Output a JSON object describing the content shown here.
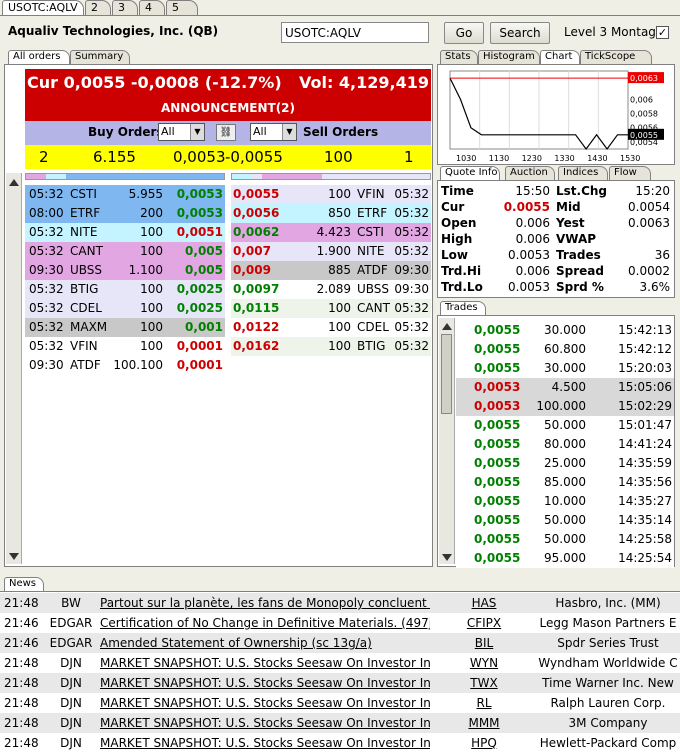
{
  "top_tabs": [
    "USOTC:AQLV",
    "2",
    "3",
    "4",
    "5"
  ],
  "header": {
    "company": "Aqualiv Technologies, Inc. (QB)",
    "symbol_value": "USOTC:AQLV",
    "go_label": "Go",
    "search_label": "Search",
    "montage_label": "Level 3 Montage",
    "montage_checked": true
  },
  "left_tabs": [
    "All orders",
    "Summary"
  ],
  "summary": {
    "cur": "Cur 0,0055 -0,0008 (-12.7%)",
    "vol": "Vol: 4,129,419",
    "announcement": "ANNOUNCEMENT(2)"
  },
  "filter": {
    "buy_label": "Buy Orders",
    "buy_select": "All",
    "sell_select": "All",
    "sell_label": "Sell Orders"
  },
  "totals": {
    "buy_count": "2",
    "buy_size": "6.155",
    "buy_price": "0,0053",
    "sell_price": "-0,0055",
    "sell_size": "100",
    "sell_count": "1"
  },
  "buy_orders": [
    {
      "time": "05:32",
      "mm": "CSTI",
      "size": "5.955",
      "price": "0,0053",
      "bg": "#7fb7f0"
    },
    {
      "time": "08:00",
      "mm": "ETRF",
      "size": "200",
      "price": "0,0053",
      "bg": "#7fb7f0"
    },
    {
      "time": "05:32",
      "mm": "NITE",
      "size": "100",
      "price": "0,0051",
      "bg": "#c4f4ff"
    },
    {
      "time": "05:32",
      "mm": "CANT",
      "size": "100",
      "price": "0,005",
      "bg": "#e2a6e2"
    },
    {
      "time": "09:30",
      "mm": "UBSS",
      "size": "1.100",
      "price": "0,005",
      "bg": "#e2a6e2"
    },
    {
      "time": "05:32",
      "mm": "BTIG",
      "size": "100",
      "price": "0,0025",
      "bg": "#e6e6f8"
    },
    {
      "time": "05:32",
      "mm": "CDEL",
      "size": "100",
      "price": "0,0025",
      "bg": "#e6e6f8"
    },
    {
      "time": "05:32",
      "mm": "MAXM",
      "size": "100",
      "price": "0,001",
      "bg": "#c8c8c8"
    },
    {
      "time": "05:32",
      "mm": "VFIN",
      "size": "100",
      "price": "0,0001",
      "bg": "#ffffff"
    },
    {
      "time": "09:30",
      "mm": "ATDF",
      "size": "100.100",
      "price": "0,0001",
      "bg": "#ffffff"
    }
  ],
  "sell_orders": [
    {
      "price": "0,0055",
      "size": "100",
      "mm": "VFIN",
      "time": "05:32",
      "bg": "#e6e6f8",
      "red": true
    },
    {
      "price": "0,0056",
      "size": "850",
      "mm": "ETRF",
      "time": "05:32",
      "bg": "#c4f4ff",
      "red": true
    },
    {
      "price": "0,0062",
      "size": "4.423",
      "mm": "CSTI",
      "time": "05:32",
      "bg": "#e2a6e2",
      "red": false
    },
    {
      "price": "0,007",
      "size": "1.900",
      "mm": "NITE",
      "time": "05:32",
      "bg": "#e6e6f8",
      "red": true
    },
    {
      "price": "0,009",
      "size": "885",
      "mm": "ATDF",
      "time": "09:30",
      "bg": "#c8c8c8",
      "red": true
    },
    {
      "price": "0,0097",
      "size": "2.089",
      "mm": "UBSS",
      "time": "09:30",
      "bg": "#ffffff",
      "red": false
    },
    {
      "price": "0,0115",
      "size": "100",
      "mm": "CANT",
      "time": "05:32",
      "bg": "#eef4ea",
      "red": false
    },
    {
      "price": "0,0122",
      "size": "100",
      "mm": "CDEL",
      "time": "05:32",
      "bg": "#ffffff",
      "red": true
    },
    {
      "price": "0,0162",
      "size": "100",
      "mm": "BTIG",
      "time": "05:32",
      "bg": "#eef4ea",
      "red": true
    }
  ],
  "right_tabs": [
    "Stats",
    "Histogram",
    "Chart",
    "TickScope"
  ],
  "chart": {
    "y_labels": [
      "0,0063",
      "0,006",
      "0,0058",
      "0,0056",
      "0,0055",
      "0,0054"
    ],
    "x_labels": [
      "1030",
      "1130",
      "1230",
      "1330",
      "1430",
      "1530"
    ]
  },
  "chart_data": {
    "type": "line",
    "x": [
      "09:30",
      "09:45",
      "10:00",
      "10:30",
      "11:00",
      "11:30",
      "12:00",
      "12:30",
      "13:00",
      "13:30",
      "14:00",
      "14:30",
      "15:00",
      "15:10",
      "15:20",
      "15:30",
      "15:40",
      "15:50"
    ],
    "values": [
      0.0063,
      0.006,
      0.0056,
      0.0055,
      0.0055,
      0.0055,
      0.0055,
      0.0055,
      0.0055,
      0.0055,
      0.0055,
      0.0055,
      0.0055,
      0.0053,
      0.0055,
      0.0053,
      0.0055,
      0.0055
    ],
    "yticks": [
      "0,0063",
      "0,006",
      "0,0058",
      "0,0056",
      "0,0055",
      "0,0054"
    ],
    "xticks": [
      "1030",
      "1130",
      "1230",
      "1330",
      "1430",
      "1530"
    ]
  },
  "quote_tabs": [
    "Quote Info",
    "Auction",
    "Indices",
    "Flow"
  ],
  "quote": [
    {
      "l1": "Time",
      "v1": "15:50",
      "l2": "Lst.Chg",
      "v2": "15:20",
      "red1": false
    },
    {
      "l1": "Cur",
      "v1": "0.0055",
      "l2": "Mid",
      "v2": "0.0054",
      "red1": true
    },
    {
      "l1": "Open",
      "v1": "0.006",
      "l2": "Yest",
      "v2": "0.0063",
      "red1": false
    },
    {
      "l1": "High",
      "v1": "0.006",
      "l2": "VWAP",
      "v2": "",
      "red1": false
    },
    {
      "l1": "Low",
      "v1": "0.0053",
      "l2": "Trades",
      "v2": "36",
      "red1": false
    },
    {
      "l1": "Trd.Hi",
      "v1": "0.006",
      "l2": "Spread",
      "v2": "0.0002",
      "red1": false
    },
    {
      "l1": "Trd.Lo",
      "v1": "0.0053",
      "l2": "Sprd %",
      "v2": "3.6%",
      "red1": false
    }
  ],
  "trades_tab": "Trades",
  "trades": [
    {
      "price": "0,0055",
      "size": "30.000",
      "time": "15:42:13",
      "red": false
    },
    {
      "price": "0,0055",
      "size": "60.800",
      "time": "15:42:12",
      "red": false
    },
    {
      "price": "0,0055",
      "size": "30.000",
      "time": "15:20:03",
      "red": false
    },
    {
      "price": "0,0053",
      "size": "4.500",
      "time": "15:05:06",
      "red": true
    },
    {
      "price": "0,0053",
      "size": "100.000",
      "time": "15:02:29",
      "red": true
    },
    {
      "price": "0,0055",
      "size": "50.000",
      "time": "15:01:47",
      "red": false
    },
    {
      "price": "0,0055",
      "size": "80.000",
      "time": "14:41:24",
      "red": false
    },
    {
      "price": "0,0055",
      "size": "25.000",
      "time": "14:35:59",
      "red": false
    },
    {
      "price": "0,0055",
      "size": "85.000",
      "time": "14:35:56",
      "red": false
    },
    {
      "price": "0,0055",
      "size": "10.000",
      "time": "14:35:27",
      "red": false
    },
    {
      "price": "0,0055",
      "size": "50.000",
      "time": "14:35:14",
      "red": false
    },
    {
      "price": "0,0055",
      "size": "50.000",
      "time": "14:25:58",
      "red": false
    },
    {
      "price": "0,0055",
      "size": "95.000",
      "time": "14:25:54",
      "red": false
    }
  ],
  "news_tab": "News",
  "news": [
    {
      "time": "21:48",
      "src": "BW",
      "headline": "Partout sur la planète, les fans de Monopoly concluent que...",
      "sym": "HAS",
      "company": "Hasbro, Inc. (MM)"
    },
    {
      "time": "21:46",
      "src": "EDGAR",
      "headline": "Certification of No Change in Definitive Materials. (497j)",
      "sym": "CFIPX",
      "company": "Legg Mason Partners E"
    },
    {
      "time": "21:46",
      "src": "EDGAR",
      "headline": "Amended Statement of Ownership (sc 13g/a)",
      "sym": "BIL",
      "company": "Spdr Series Trust"
    },
    {
      "time": "21:48",
      "src": "DJN",
      "headline": "MARKET SNAPSHOT: U.S. Stocks Seesaw On Investor Ind...",
      "sym": "WYN",
      "company": "Wyndham Worldwide C"
    },
    {
      "time": "21:48",
      "src": "DJN",
      "headline": "MARKET SNAPSHOT: U.S. Stocks Seesaw On Investor Ind...",
      "sym": "TWX",
      "company": "Time Warner Inc. New"
    },
    {
      "time": "21:48",
      "src": "DJN",
      "headline": "MARKET SNAPSHOT: U.S. Stocks Seesaw On Investor Ind...",
      "sym": "RL",
      "company": "Ralph Lauren Corp."
    },
    {
      "time": "21:48",
      "src": "DJN",
      "headline": "MARKET SNAPSHOT: U.S. Stocks Seesaw On Investor Ind...",
      "sym": "MMM",
      "company": "3M Company"
    },
    {
      "time": "21:48",
      "src": "DJN",
      "headline": "MARKET SNAPSHOT: U.S. Stocks Seesaw On Investor Ind...",
      "sym": "HPQ",
      "company": "Hewlett-Packard Comp"
    }
  ],
  "colors": {
    "red_header": "#cc0000",
    "filter_bg": "#b4b4e6",
    "yellow": "#ffff00",
    "green": "#008000",
    "red": "#cc0000"
  }
}
